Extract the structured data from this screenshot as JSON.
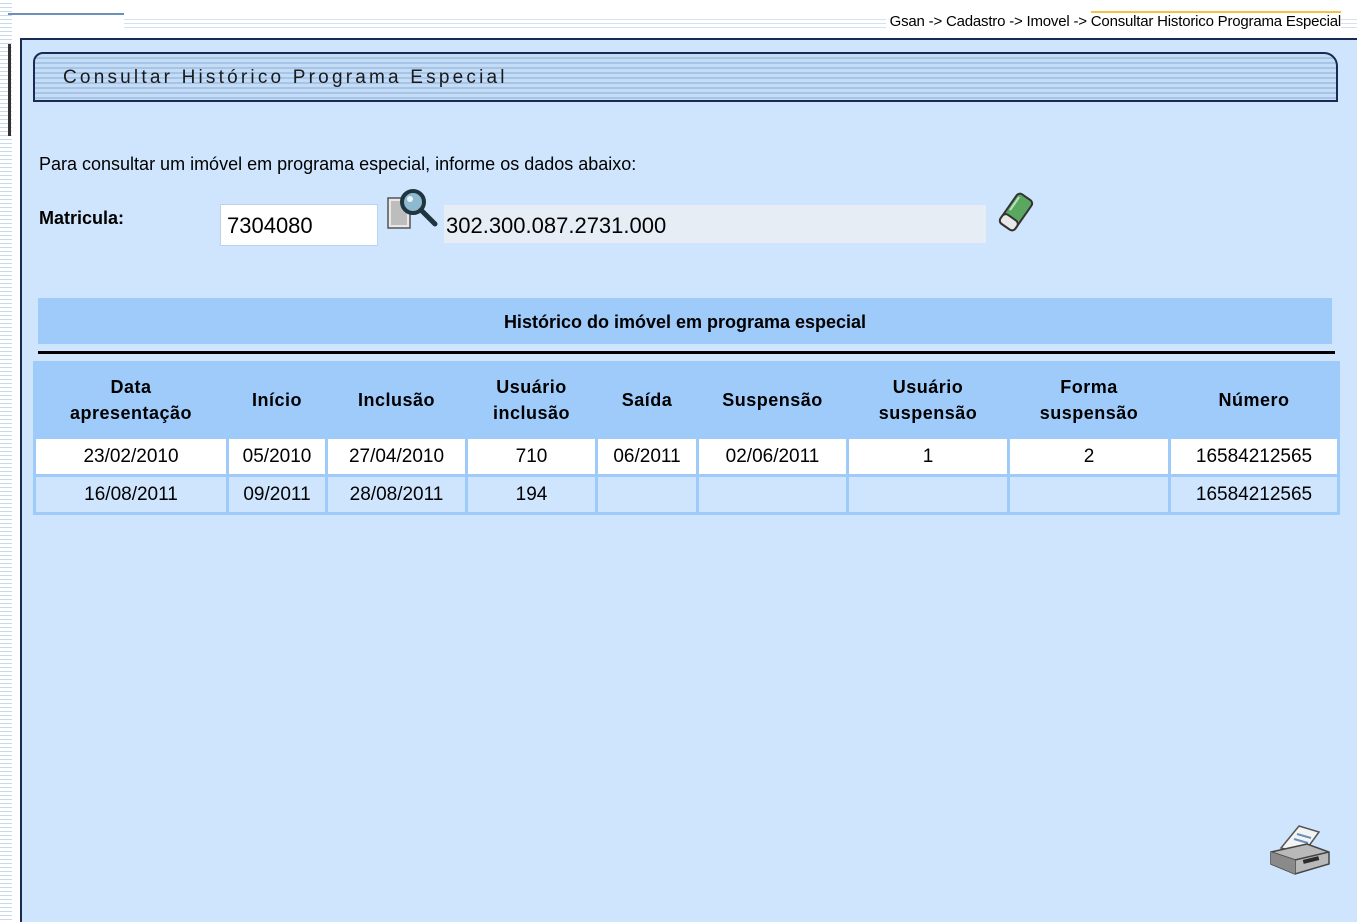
{
  "breadcrumb": {
    "prefix": "Gsan -> Cadastro -> Imovel -> ",
    "current": "Consultar Historico Programa Especial"
  },
  "page": {
    "title": "Consultar Histórico Programa Especial",
    "instruction": "Para consultar um imóvel em programa especial, informe os dados abaixo:"
  },
  "form": {
    "matricula_label": "Matricula:",
    "matricula_value": "7304080",
    "address_value": "302.300.087.2731.000"
  },
  "history": {
    "section_title": "Histórico do imóvel em programa especial",
    "columns": [
      {
        "line1": "Data",
        "line2": "apresentação"
      },
      {
        "line1": "Início",
        "line2": ""
      },
      {
        "line1": "Inclusão",
        "line2": ""
      },
      {
        "line1": "Usuário",
        "line2": "inclusão"
      },
      {
        "line1": "Saída",
        "line2": ""
      },
      {
        "line1": "Suspensão",
        "line2": ""
      },
      {
        "line1": "Usuário",
        "line2": "suspensão"
      },
      {
        "line1": "Forma",
        "line2": "suspensão"
      },
      {
        "line1": "Número",
        "line2": ""
      }
    ],
    "rows": [
      [
        "23/02/2010",
        "05/2010",
        "27/04/2010",
        "710",
        "06/2011",
        "02/06/2011",
        "1",
        "2",
        "16584212565"
      ],
      [
        "16/08/2011",
        "09/2011",
        "28/08/2011",
        "194",
        "",
        "",
        "",
        "",
        "16584212565"
      ]
    ]
  },
  "icons": {
    "search": "search-icon",
    "clear": "eraser-icon",
    "print": "printer-icon"
  },
  "colors": {
    "panel_bg": "#cfe5fd",
    "header_bg": "#9fcbfb",
    "border_dark": "#1a2a55",
    "readonly_field": "#e6edf5"
  }
}
